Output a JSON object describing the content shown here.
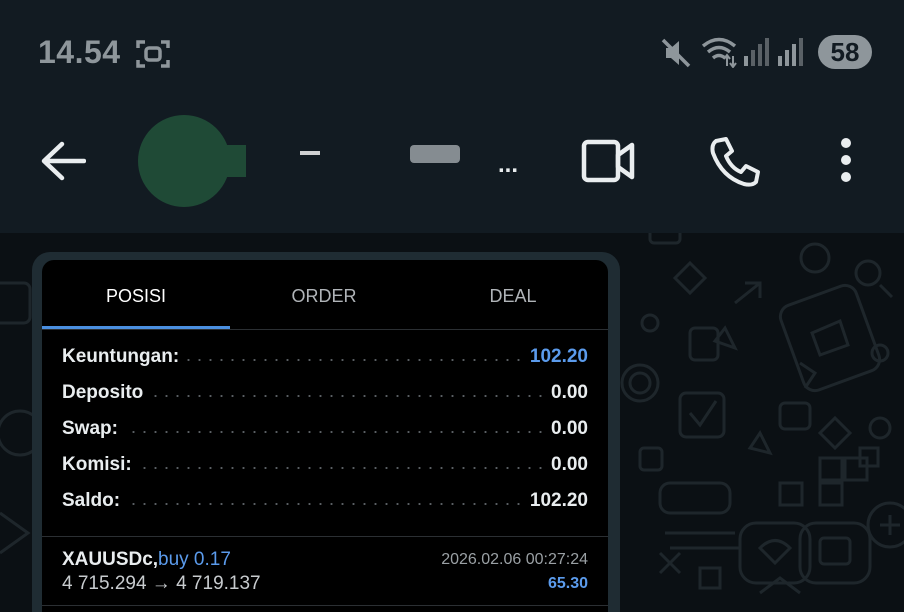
{
  "status_bar": {
    "time": "14.54",
    "battery": "58",
    "icons": [
      "screenshot-icon",
      "mute-icon",
      "wifi-icon",
      "signal-icon",
      "signal-icon"
    ]
  },
  "app_bar": {
    "contact_name_ellipsis": "...",
    "icons": [
      "back-arrow-icon",
      "video-call-icon",
      "phone-icon",
      "more-vert-icon"
    ]
  },
  "terminal": {
    "tabs": [
      {
        "label": "POSISI",
        "active": true
      },
      {
        "label": "ORDER",
        "active": false
      },
      {
        "label": "DEAL",
        "active": false
      }
    ],
    "summary": [
      {
        "label": "Keuntungan:",
        "value": "102.20",
        "accent": true
      },
      {
        "label": "Deposito",
        "value": "0.00",
        "accent": false
      },
      {
        "label": "Swap:",
        "value": "0.00",
        "accent": false
      },
      {
        "label": "Komisi:",
        "value": "0.00",
        "accent": false
      },
      {
        "label": "Saldo:",
        "value": "102.20",
        "accent": false
      }
    ],
    "position": {
      "symbol": "XAUUSDc,",
      "side": "buy 0.17",
      "prices": "4 715.294 → 4 719.137",
      "time": "2026.02.06 00:27:24",
      "profit": "65.30"
    }
  },
  "colors": {
    "header_bg": "#121b22",
    "chat_bg": "#0b1014",
    "accent_blue": "#5b9bec",
    "avatar_green": "#1f4a36"
  }
}
